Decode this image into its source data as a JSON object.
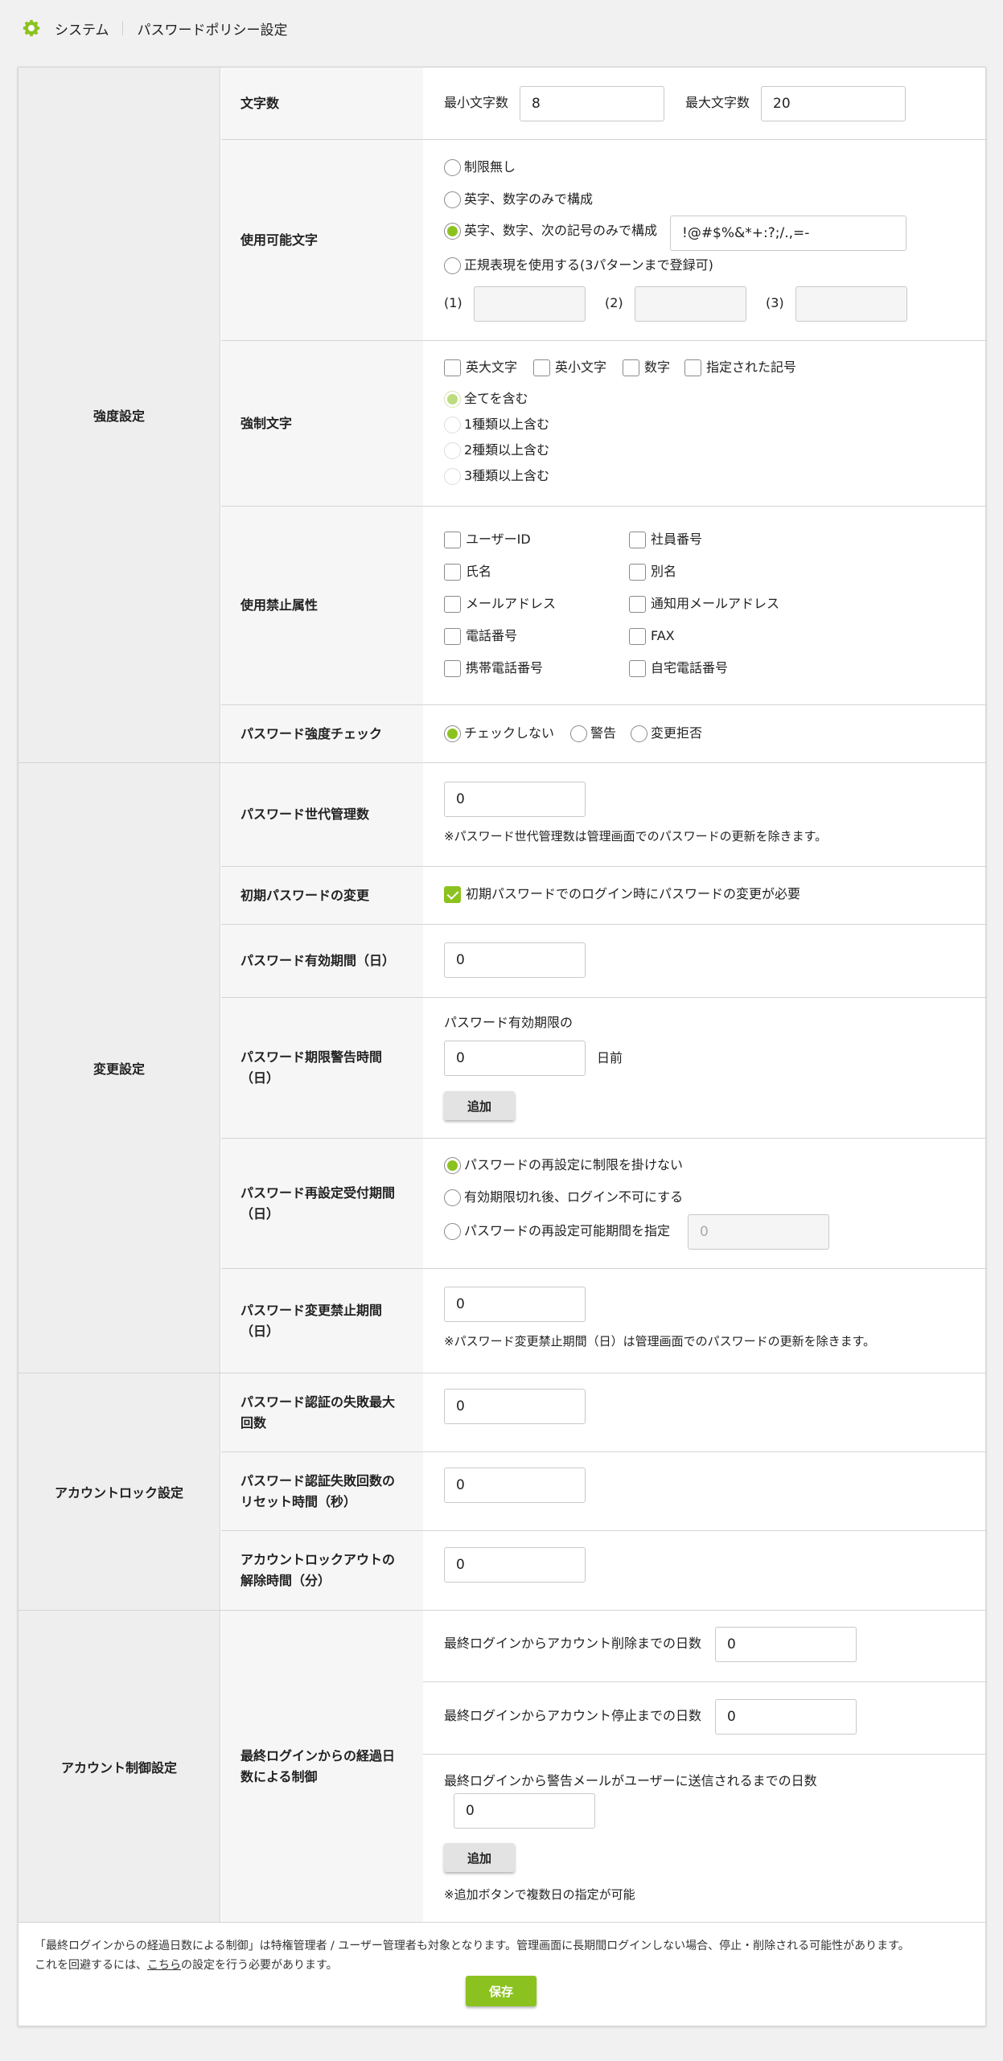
{
  "header": {
    "app": "システム",
    "page": "パスワードポリシー設定"
  },
  "sections": {
    "strength": "強度設定",
    "change": "変更設定",
    "lock": "アカウントロック設定",
    "control": "アカウント制御設定"
  },
  "length": {
    "label": "文字数",
    "min_label": "最小文字数",
    "min": "8",
    "max_label": "最大文字数",
    "max": "20"
  },
  "allowed": {
    "label": "使用可能文字",
    "opt1": "制限無し",
    "opt2": "英字、数字のみで構成",
    "opt3": "英字、数字、次の記号のみで構成",
    "symbols": "!@#$%&*+:?;/.,=-",
    "opt4": "正規表現を使用する(3パターンまで登録可)",
    "r1": "(1)",
    "r2": "(2)",
    "r3": "(3)"
  },
  "required": {
    "label": "強制文字",
    "c1": "英大文字",
    "c2": "英小文字",
    "c3": "数字",
    "c4": "指定された記号",
    "r1": "全てを含む",
    "r2": "1種類以上含む",
    "r3": "2種類以上含む",
    "r4": "3種類以上含む"
  },
  "forbidden": {
    "label": "使用禁止属性",
    "a1": "ユーザーID",
    "a2": "社員番号",
    "a3": "氏名",
    "a4": "別名",
    "a5": "メールアドレス",
    "a6": "通知用メールアドレス",
    "a7": "電話番号",
    "a8": "FAX",
    "a9": "携帯電話番号",
    "a10": "自宅電話番号"
  },
  "strength_check": {
    "label": "パスワード強度チェック",
    "r1": "チェックしない",
    "r2": "警告",
    "r3": "変更拒否"
  },
  "history": {
    "label": "パスワード世代管理数",
    "value": "0",
    "note": "※パスワード世代管理数は管理画面でのパスワードの更新を除きます。"
  },
  "initial": {
    "label": "初期パスワードの変更",
    "check": "初期パスワードでのログイン時にパスワードの変更が必要"
  },
  "validity": {
    "label": "パスワード有効期間（日）",
    "value": "0"
  },
  "warning": {
    "label1": "パスワード期限警告時間",
    "label2": "（日）",
    "prefix": "パスワード有効期限の",
    "value": "0",
    "suffix": "日前",
    "add": "追加"
  },
  "reset": {
    "label1": "パスワード再設定受付期間",
    "label2": "（日）",
    "r1": "パスワードの再設定に制限を掛けない",
    "r2": "有効期限切れ後、ログイン不可にする",
    "r3": "パスワードの再設定可能期間を指定",
    "value": "0"
  },
  "prohibit": {
    "label1": "パスワード変更禁止期間",
    "label2": "（日）",
    "value": "0",
    "note": "※パスワード変更禁止期間（日）は管理画面でのパスワードの更新を除きます。"
  },
  "fail_max": {
    "label1": "パスワード認証の失敗最大",
    "label2": "回数",
    "value": "0"
  },
  "fail_reset": {
    "label1": "パスワード認証失敗回数の",
    "label2": "リセット時間（秒）",
    "value": "0"
  },
  "unlock": {
    "label1": "アカウントロックアウトの",
    "label2": "解除時間（分）",
    "value": "0"
  },
  "elapsed": {
    "label1": "最終ログインからの経過日",
    "label2": "数による制御",
    "delete_label": "最終ログインからアカウント削除までの日数",
    "delete_value": "0",
    "stop_label": "最終ログインからアカウント停止までの日数",
    "stop_value": "0",
    "mail_label": "最終ログインから警告メールがユーザーに送信されるまでの日数",
    "mail_value": "0",
    "add": "追加",
    "note": "※追加ボタンで複数日の指定が可能"
  },
  "footer": {
    "line1": "「最終ログインからの経過日数による制御」は特権管理者 / ユーザー管理者も対象となります。管理画面に長期間ログインしない場合、停止・削除される可能性があります。",
    "line2_a": "これを回避するには、",
    "link": "こちら",
    "line2_b": "の設定を行う必要があります。",
    "save": "保存"
  },
  "colors": {
    "accent": "#8cc21f",
    "section_bg": "#eeeeee",
    "label_bg": "#f6f6f6"
  }
}
